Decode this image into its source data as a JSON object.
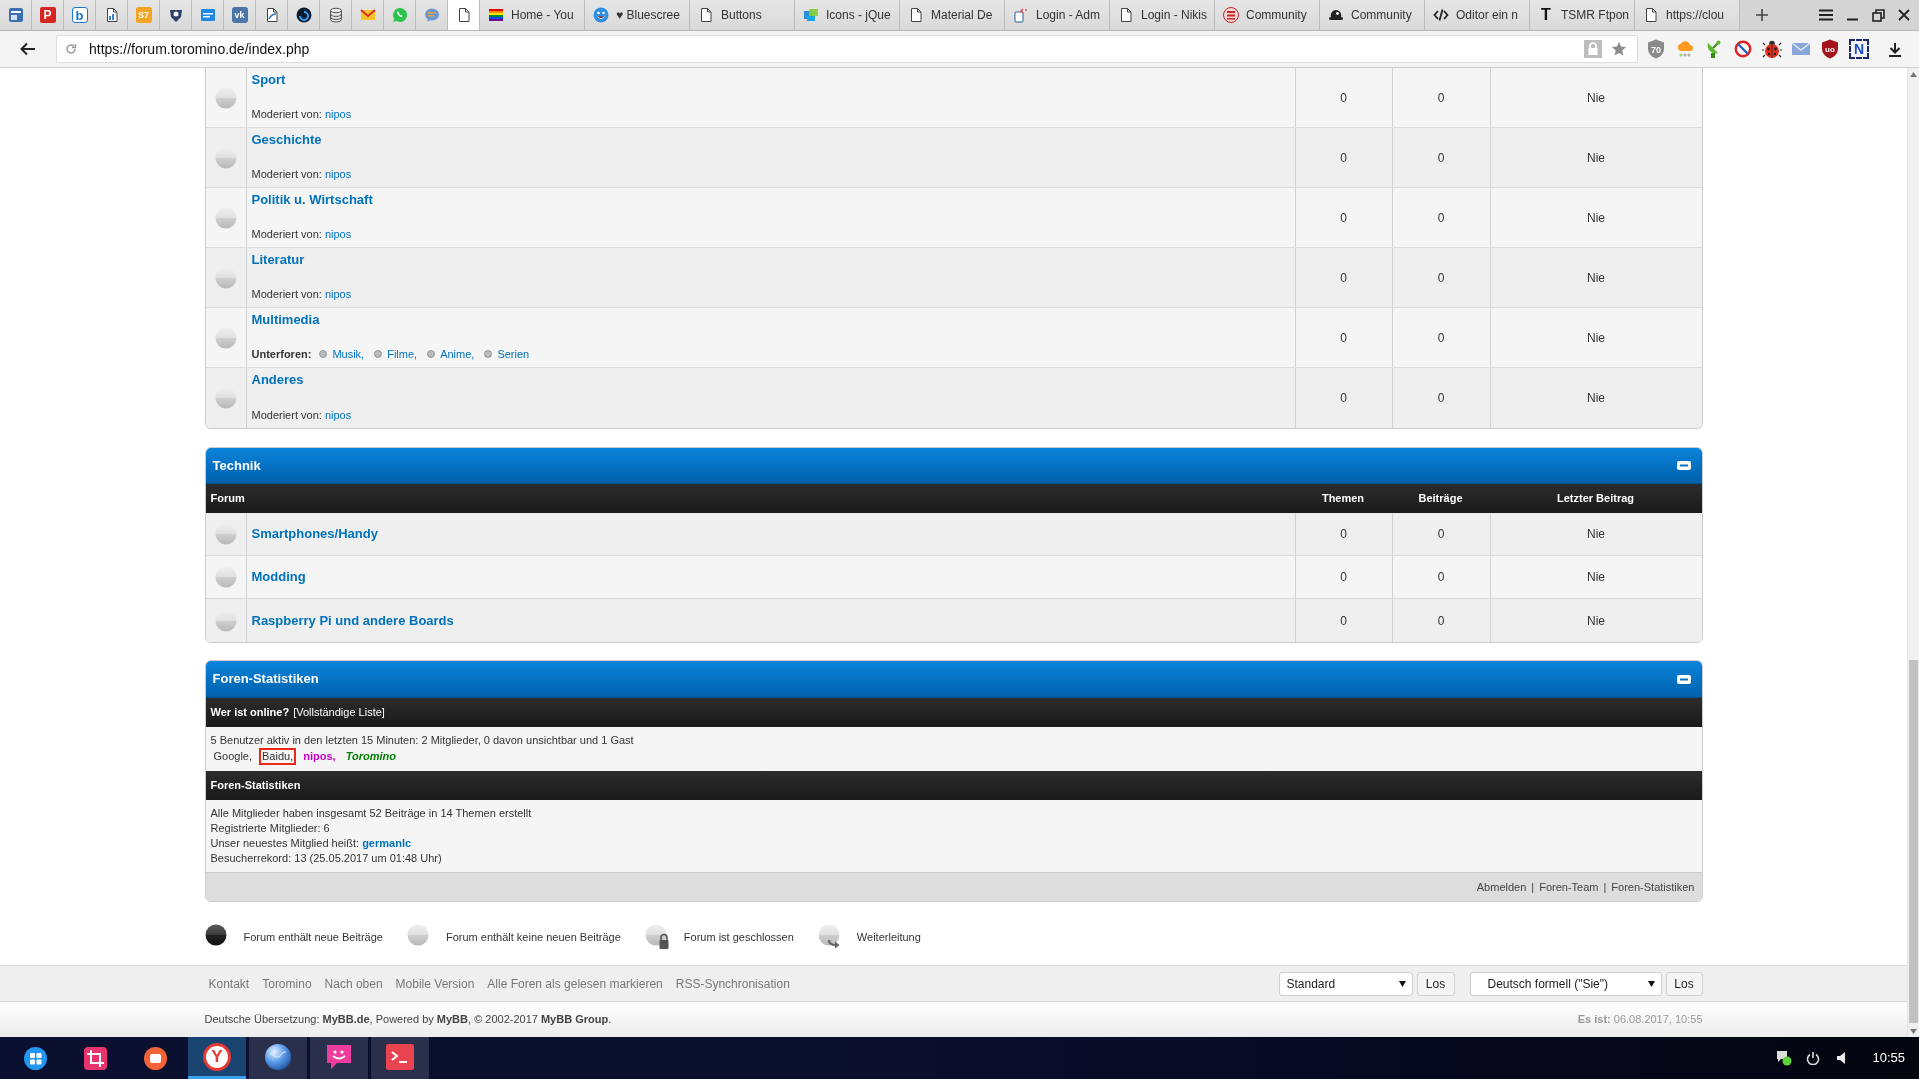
{
  "browser": {
    "pinned_tabs": [
      {
        "kind": "app",
        "selected": false
      },
      {
        "kind": "p-logo",
        "glyph": "P",
        "selected": false
      },
      {
        "kind": "b-logo",
        "glyph": "b",
        "selected": false
      },
      {
        "kind": "doc-chart",
        "selected": false
      },
      {
        "kind": "s7-logo",
        "glyph": "S7",
        "selected": false
      },
      {
        "kind": "crest",
        "selected": false
      },
      {
        "kind": "blue-tile",
        "selected": false
      },
      {
        "kind": "vk-logo",
        "glyph": "vk",
        "selected": false
      },
      {
        "kind": "doc-arrow",
        "selected": false
      },
      {
        "kind": "swirl",
        "selected": false
      },
      {
        "kind": "database",
        "selected": false
      },
      {
        "kind": "mail",
        "selected": false
      },
      {
        "kind": "phone-bubble",
        "selected": false
      },
      {
        "kind": "chat",
        "selected": false
      },
      {
        "kind": "page",
        "selected": true
      }
    ],
    "tabs": [
      {
        "kind": "flag",
        "title": "Home - You",
        "selected": false
      },
      {
        "kind": "smiley",
        "title": "♥ Bluescree",
        "selected": false
      },
      {
        "kind": "page",
        "title": "Buttons",
        "selected": false
      },
      {
        "kind": "tiles",
        "title": "Icons - jQue",
        "selected": false
      },
      {
        "kind": "page",
        "title": "Material De",
        "selected": false
      },
      {
        "kind": "doc-code",
        "title": "Login - Adm",
        "selected": false
      },
      {
        "kind": "page",
        "title": "Login - Nikis",
        "selected": false
      },
      {
        "kind": "emblem",
        "title": "Community",
        "selected": false
      },
      {
        "kind": "blob",
        "title": "Community",
        "selected": false
      },
      {
        "kind": "code",
        "title": "Oditor ein n",
        "selected": false
      },
      {
        "kind": "t-logo",
        "glyph": "T",
        "title": "TSMR Ftpon",
        "selected": false
      },
      {
        "kind": "page",
        "title": "https://clou",
        "selected": false
      }
    ],
    "url": "https://forum.toromino.de/index.php",
    "extensions": [
      {
        "kind": "shield",
        "glyph": "70"
      },
      {
        "kind": "cloud"
      },
      {
        "kind": "dish"
      },
      {
        "kind": "ban"
      },
      {
        "kind": "bug"
      },
      {
        "kind": "mail"
      },
      {
        "kind": "ublock",
        "glyph": "uo"
      },
      {
        "kind": "n-box",
        "glyph": "N"
      }
    ]
  },
  "forums": [
    {
      "unread": false,
      "title": "Sport",
      "moderator_label": "Moderiert von:",
      "moderator": "nipos",
      "threads": "0",
      "posts": "0",
      "last_post": "Nie"
    },
    {
      "unread": false,
      "title": "Geschichte",
      "moderator_label": "Moderiert von:",
      "moderator": "nipos",
      "threads": "0",
      "posts": "0",
      "last_post": "Nie"
    },
    {
      "unread": false,
      "title": "Politik u. Wirtschaft",
      "moderator_label": "Moderiert von:",
      "moderator": "nipos",
      "threads": "0",
      "posts": "0",
      "last_post": "Nie"
    },
    {
      "unread": false,
      "title": "Literatur",
      "moderator_label": "Moderiert von:",
      "moderator": "nipos",
      "threads": "0",
      "posts": "0",
      "last_post": "Nie"
    },
    {
      "unread": false,
      "title": "Multimedia",
      "subforums_label": "Unterforen:",
      "subforums": [
        "Musik,",
        "Filme,",
        "Anime,",
        "Serien"
      ],
      "threads": "0",
      "posts": "0",
      "last_post": "Nie"
    },
    {
      "unread": false,
      "title": "Anderes",
      "moderator_label": "Moderiert von:",
      "moderator": "nipos",
      "threads": "0",
      "posts": "0",
      "last_post": "Nie"
    }
  ],
  "technik": {
    "title": "Technik",
    "columns": [
      "Forum",
      "Themen",
      "Beiträge",
      "Letzter Beitrag"
    ],
    "forums": [
      {
        "unread": false,
        "title": "Smartphones/Handy",
        "threads": "0",
        "posts": "0",
        "last_post": "Nie"
      },
      {
        "unread": false,
        "title": "Modding",
        "threads": "0",
        "posts": "0",
        "last_post": "Nie"
      },
      {
        "unread": false,
        "title": "Raspberry Pi und andere Boards",
        "threads": "0",
        "posts": "0",
        "last_post": "Nie"
      }
    ]
  },
  "stats": {
    "title": "Foren-Statistiken",
    "online_heading": "Wer ist online?",
    "online_link": "[Vollständige Liste]",
    "online_summary": "5 Benutzer aktiv in den letzten 15 Minuten: 2 Mitglieder, 0 davon unsichtbar und 1 Gast",
    "users": [
      {
        "name": "Google,",
        "kind": "bot",
        "color": "#333333",
        "highlighted": false
      },
      {
        "name": "Baidu,",
        "kind": "bot",
        "color": "#333333",
        "highlighted": true
      },
      {
        "name": "nipos,",
        "kind": "moderator",
        "color": "#cc00cc",
        "highlighted": false
      },
      {
        "name": "Toromino",
        "kind": "admin",
        "color": "#008000",
        "highlighted": false
      }
    ],
    "stats_heading": "Foren-Statistiken",
    "lines": [
      {
        "text": "Alle Mitglieder haben insgesamt 52 Beiträge in 14 Themen erstellt"
      },
      {
        "text": "Registrierte Mitglieder: 6"
      },
      {
        "text": "Unser neuestes Mitglied heißt:",
        "link": "germanlc"
      },
      {
        "text": "Besucherrekord: 13 (25.05.2017 um 01:48 Uhr)"
      }
    ],
    "links": [
      "Abmelden",
      "Foren-Team",
      "Foren-Statistiken"
    ],
    "separator": "|"
  },
  "legend": [
    {
      "kind": "new",
      "label": "Forum enthält neue Beiträge"
    },
    {
      "kind": "none",
      "label": "Forum enthält keine neuen Beiträge"
    },
    {
      "kind": "locked",
      "label": "Forum ist geschlossen"
    },
    {
      "kind": "redirect",
      "label": "Weiterleitung"
    }
  ],
  "footer": {
    "links": [
      "Kontakt",
      "Toromino",
      "Nach oben",
      "Mobile Version",
      "Alle Foren als gelesen markieren",
      "RSS-Synchronisation"
    ],
    "theme_select": "Standard",
    "theme_button": "Los",
    "language_select": "Deutsch formell (\"Sie\")",
    "language_button": "Los",
    "copyright": "Deutsche Übersetzung: **MyBB.de**, Powered by **MyBB**, © 2002-2017 **MyBB Group**.",
    "date": "**Es ist:** 06.08.2017, 10:55"
  },
  "taskbar": {
    "tasks": [
      {
        "kind": "yandex",
        "glyph": "Y",
        "selected": true
      },
      {
        "kind": "globe",
        "selected": false
      },
      {
        "kind": "chat",
        "selected": false
      },
      {
        "kind": "terminal",
        "selected": false
      }
    ],
    "clock": "10:55"
  }
}
